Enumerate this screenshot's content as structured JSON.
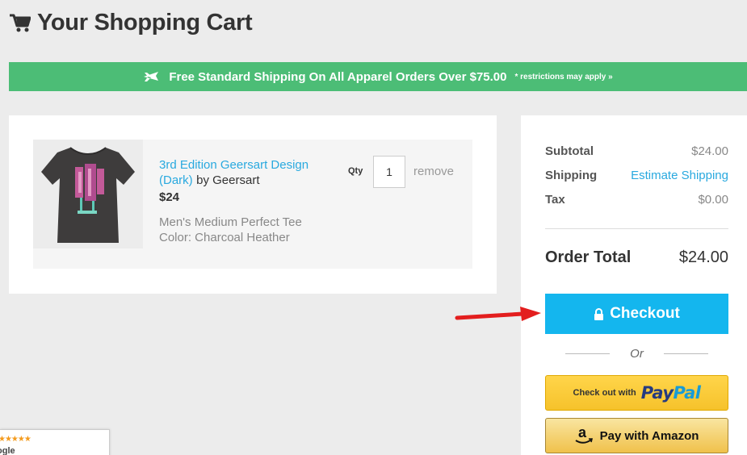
{
  "header": {
    "title": "Your Shopping Cart",
    "icon": "shopping-cart-icon"
  },
  "banner": {
    "text": "Free Standard Shipping On All Apparel Orders Over $75.00",
    "note": "* restrictions may apply »",
    "icon": "airplane-icon",
    "color": "#4cbd76"
  },
  "cart": {
    "items": [
      {
        "title": "3rd Edition Geersart Design (Dark)",
        "by": "by Geersart",
        "price": "$24",
        "variant": "Men's Medium Perfect Tee",
        "color": "Color: Charcoal Heather",
        "qty_label": "Qty",
        "qty": "1",
        "remove_label": "remove"
      }
    ]
  },
  "summary": {
    "subtotal_label": "Subtotal",
    "subtotal_value": "$24.00",
    "shipping_label": "Shipping",
    "shipping_value": "Estimate Shipping",
    "tax_label": "Tax",
    "tax_value": "$0.00",
    "total_label": "Order Total",
    "total_value": "$24.00"
  },
  "checkout": {
    "label": "Checkout",
    "color": "#14b6ee"
  },
  "or_label": "Or",
  "paypal": {
    "prefix": "Check out with",
    "brand_pay": "Pay",
    "brand_pal": "Pal"
  },
  "amazon": {
    "label": "Pay with Amazon"
  },
  "reviews_badge": {
    "stars": "★★★★★",
    "source": "ogle"
  }
}
